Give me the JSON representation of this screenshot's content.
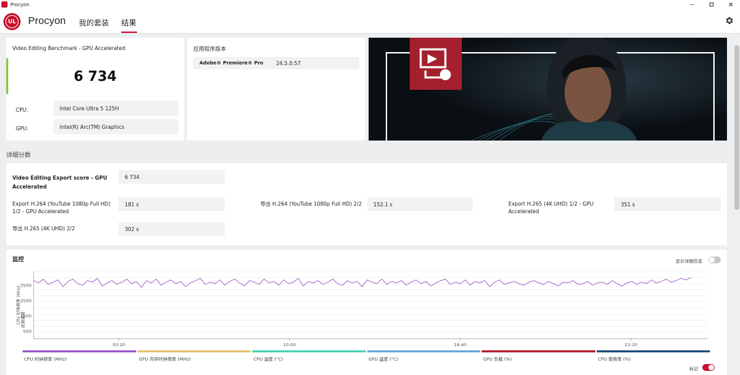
{
  "window": {
    "title": "Procyon"
  },
  "header": {
    "brand": "Procyon",
    "logo_text": "UL",
    "tabs": [
      {
        "label": "我的套装"
      },
      {
        "label": "结果"
      }
    ]
  },
  "result": {
    "benchmark_name": "Video Editing Benchmark - GPU Accelerated",
    "score": "6 734",
    "cpu_label": "CPU:",
    "cpu_value": "Intel Core Ultra 5 125H",
    "gpu_label": "GPU:",
    "gpu_value": "Intel(R) Arc(TM) Graphics"
  },
  "app_version": {
    "title": "应用程序版本",
    "app_name": "Adobe® Premiere® Pro",
    "version": "24.5.0.57"
  },
  "details": {
    "title": "详细分数",
    "main_label": "Video Editing Export score - GPU Accelerated",
    "main_value": "6 734",
    "items": [
      {
        "label": "Export H.264 (YouTube 1080p Full HD) 1/2 - GPU Accelerated",
        "value": "181 s"
      },
      {
        "label": "导出 H.264 (YouTube 1080p Full HD) 2/2",
        "value": "152.1 s"
      },
      {
        "label": "Export H.265 (4K UHD) 1/2 - GPU Accelerated",
        "value": "351 s"
      },
      {
        "label": "导出 H.265 (4K UHD) 2/2",
        "value": "302 s"
      }
    ]
  },
  "monitor": {
    "title": "监控",
    "detail_toggle_label": "显示详细信息",
    "marker_label": "标记",
    "marker_on": true,
    "detail_on": false,
    "colors": {
      "cpu_clock": "#9b59c6",
      "gpu_mem_clock": "#e8c27a",
      "cpu_temp": "#4fd1b5",
      "gpu_temp": "#6fa8d6",
      "gpu_load": "#b5202e",
      "cpu_usage": "#1f4e79",
      "accent": "#c8102e"
    },
    "legend": [
      {
        "name": "CPU 时钟频率 (MHz)",
        "color": "#9b59c6"
      },
      {
        "name": "GPU 内存时钟频率 (MHz)",
        "color": "#e8c27a"
      },
      {
        "name": "CPU 温度 (°C)",
        "color": "#4fd1b5"
      },
      {
        "name": "GPU 温度 (°C)",
        "color": "#6fa8d6"
      },
      {
        "name": "GPU 负载 (%)",
        "color": "#b5202e"
      },
      {
        "name": "CPU 使用率 (%)",
        "color": "#1f4e79"
      }
    ]
  },
  "chart_data": {
    "type": "line",
    "title": "",
    "ylabel": "CPU 时钟频率 (MHz)",
    "ylabel_secondary": "视频编辑",
    "xlabel": "",
    "y_ticks": [
      500,
      1500,
      2500,
      3500
    ],
    "y_tick_labels": [
      "500",
      "1500",
      "2500",
      "3500"
    ],
    "ylim": [
      0,
      4400
    ],
    "x_ticks": [
      "03:20",
      "10:00",
      "16:40",
      "23:20"
    ],
    "x_tick_values": [
      200,
      600,
      1000,
      1400
    ],
    "xlim": [
      0,
      1580
    ],
    "grid": true,
    "series": [
      {
        "name": "CPU 时钟频率 (MHz)",
        "color": "#9b59c6",
        "x_start": 0,
        "x_end": 1540,
        "values": [
          3800,
          3650,
          3900,
          3550,
          3700,
          3850,
          3400,
          3750,
          3900,
          3600,
          3500,
          3800,
          3700,
          3950,
          3450,
          3650,
          3800,
          3550,
          3700,
          3900,
          3600,
          3750,
          3350,
          3800,
          3650,
          3900,
          3500,
          3700,
          3850,
          3600,
          3750,
          3400,
          3650,
          3800,
          3950,
          3550,
          3700,
          3600,
          3850,
          3500,
          3750,
          3900,
          3650,
          3450,
          3800,
          3700,
          3550,
          3900,
          3650,
          3750,
          3500,
          3850,
          3600,
          3700,
          3950,
          3450,
          3750,
          3650,
          3800,
          3550,
          3700,
          3900,
          3600,
          3500,
          3800,
          3650,
          3750,
          3400,
          3850,
          3700,
          3600,
          3900,
          3550,
          3750,
          3650,
          3800,
          3500,
          3700,
          3850,
          3600,
          3750,
          3450,
          3650,
          3800,
          3900,
          3550,
          3700,
          3600,
          3850,
          3500,
          3750,
          3650,
          3800,
          3400,
          3700,
          3850,
          3550,
          3650,
          3750,
          3600,
          3500,
          3700,
          3800,
          3650,
          3550,
          3750,
          3600,
          3450,
          3700,
          3650,
          3800,
          3550,
          3600,
          3750,
          3500,
          3650,
          3700,
          3550,
          3800,
          3600,
          3450,
          3650,
          3750,
          3550,
          3700,
          3600,
          3850,
          3650,
          3750,
          3900,
          3700,
          3800,
          3950,
          3850,
          4000
        ]
      }
    ]
  }
}
